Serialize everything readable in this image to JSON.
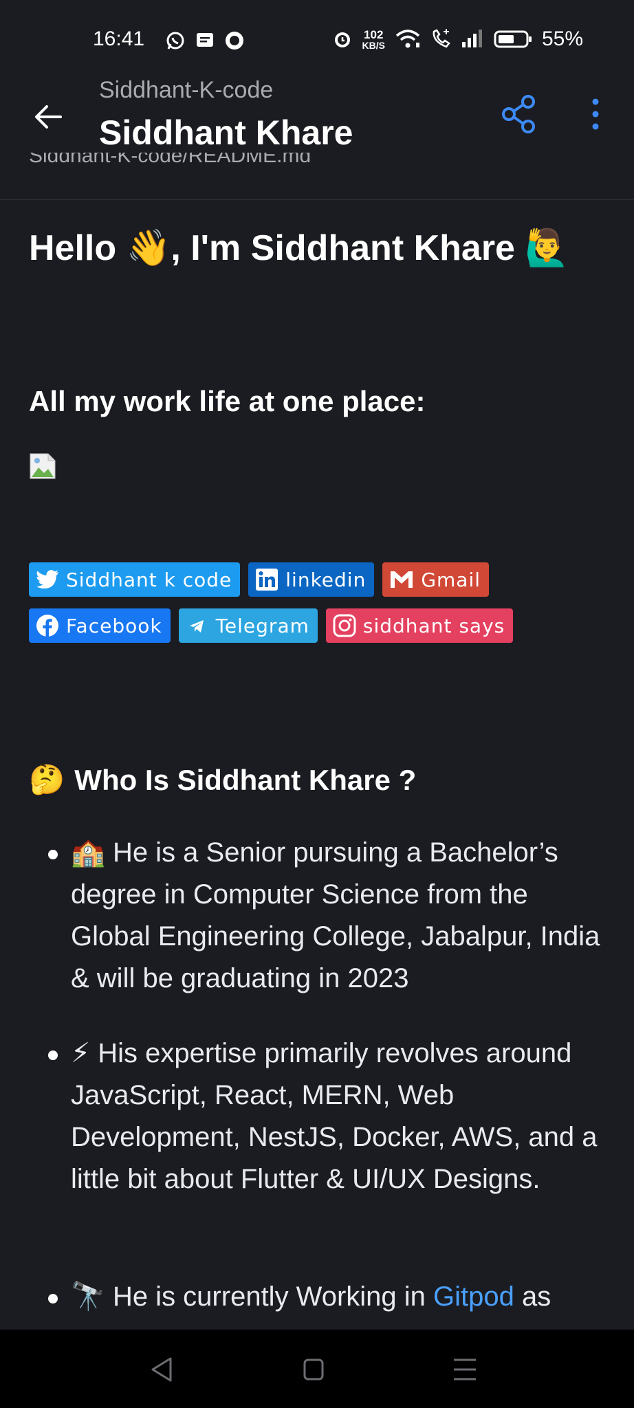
{
  "status": {
    "time": "16:41",
    "net_speed_value": "102",
    "net_speed_unit": "KB/S",
    "battery": "55%",
    "icons": [
      "whatsapp-icon",
      "message-icon",
      "record-icon",
      "alarm-icon",
      "wifi-icon",
      "volte-call-icon",
      "signal-icon",
      "battery-icon"
    ]
  },
  "header": {
    "owner": "Siddhant-K-code",
    "title": "Siddhant Khare",
    "clipped_text": "Siddhant-K-code/README.md",
    "accent": "#3d8af7"
  },
  "content": {
    "greeting": "Hello 👋, I'm Siddhant Khare 🙋‍♂️",
    "work_heading": "All my work life at one place:",
    "badges_row1": [
      {
        "label": "Siddhant k code",
        "icon": "twitter-icon",
        "color": "#1d9bf0"
      },
      {
        "label": "linkedin",
        "icon": "linkedin-icon",
        "color": "#0a66c2"
      },
      {
        "label": "Gmail",
        "icon": "gmail-icon",
        "color": "#d14836"
      }
    ],
    "badges_row2": [
      {
        "label": "Facebook",
        "icon": "facebook-icon",
        "color": "#1877f2"
      },
      {
        "label": "Telegram",
        "icon": "telegram-icon",
        "color": "#2ca5e0"
      },
      {
        "label": "siddhant says",
        "icon": "instagram-icon",
        "color": "#e4405f"
      }
    ],
    "who_heading": "Who Is Siddhant Khare ?",
    "who_emoji": "🤔",
    "bullets": [
      {
        "emoji": "🏫",
        "text": "He is a Senior pursuing a Bachelor’s degree in Computer Science from the Global Engineering College, Jabalpur, India & will be graduating in 2023"
      },
      {
        "emoji": "⚡",
        "text": "His expertise primarily revolves around JavaScript, React, MERN, Web Development, NestJS, Docker, AWS, and a little bit about Flutter & UI/UX Designs."
      },
      {
        "emoji": "🔭",
        "text_before": "He is currently Working in ",
        "link": "Gitpod",
        "text_after": " as"
      }
    ]
  },
  "navbar": {
    "icons": [
      "back-nav-icon",
      "home-nav-icon",
      "recents-nav-icon"
    ]
  }
}
